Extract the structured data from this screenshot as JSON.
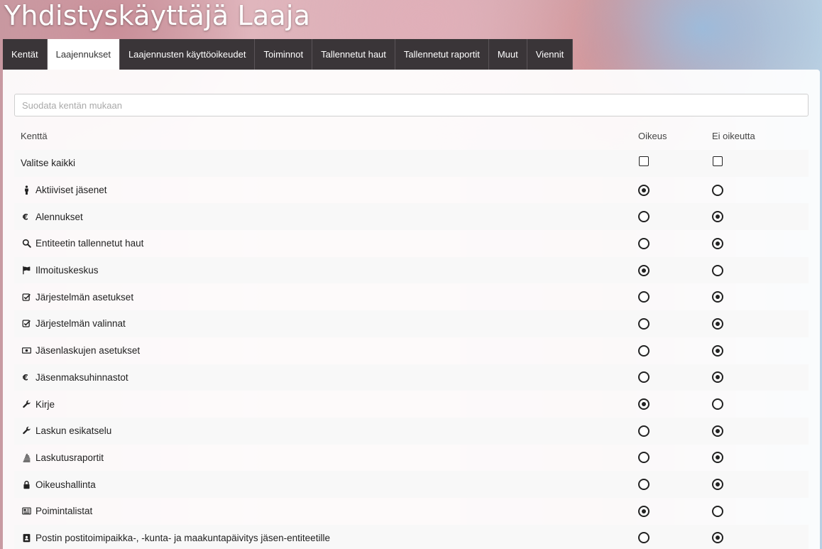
{
  "app": {
    "title": "Yhdistyskäyttäjä Laaja"
  },
  "tabs": [
    {
      "label": "Kentät",
      "active": false
    },
    {
      "label": "Laajennukset",
      "active": true
    },
    {
      "label": "Laajennusten käyttöoikeudet",
      "active": false
    },
    {
      "label": "Toiminnot",
      "active": false
    },
    {
      "label": "Tallennetut haut",
      "active": false
    },
    {
      "label": "Tallennetut raportit",
      "active": false
    },
    {
      "label": "Muut",
      "active": false
    },
    {
      "label": "Viennit",
      "active": false
    }
  ],
  "filter": {
    "placeholder": "Suodata kentän mukaan",
    "value": ""
  },
  "table": {
    "headers": {
      "field": "Kenttä",
      "right": "Oikeus",
      "no_right": "Ei oikeutta"
    },
    "select_all": {
      "label": "Valitse kaikki",
      "right_checked": false,
      "no_right_checked": false
    },
    "rows": [
      {
        "icon": "person-icon",
        "label": "Aktiiviset jäsenet",
        "value": "right"
      },
      {
        "icon": "euro-icon",
        "label": "Alennukset",
        "value": "no_right"
      },
      {
        "icon": "search-icon",
        "label": "Entiteetin tallennetut haut",
        "value": "no_right"
      },
      {
        "icon": "flag-icon",
        "label": "Ilmoituskeskus",
        "value": "right"
      },
      {
        "icon": "checkbox-checked-icon",
        "label": "Järjestelmän asetukset",
        "value": "no_right"
      },
      {
        "icon": "checkbox-checked-icon",
        "label": "Järjestelmän valinnat",
        "value": "no_right"
      },
      {
        "icon": "money-bill-icon",
        "label": "Jäsenlaskujen asetukset",
        "value": "no_right"
      },
      {
        "icon": "euro-icon",
        "label": "Jäsenmaksuhinnastot",
        "value": "no_right"
      },
      {
        "icon": "wrench-icon",
        "label": "Kirje",
        "value": "right"
      },
      {
        "icon": "wrench-icon",
        "label": "Laskun esikatselu",
        "value": "no_right"
      },
      {
        "icon": "coins-stack-icon",
        "label": "Laskutusraportit",
        "value": "no_right"
      },
      {
        "icon": "lock-icon",
        "label": "Oikeushallinta",
        "value": "no_right"
      },
      {
        "icon": "newspaper-icon",
        "label": "Poimintalistat",
        "value": "right"
      },
      {
        "icon": "contact-book-icon",
        "label": "Postin postitoimipaikka-, -kunta- ja maakuntapäivitys jäsen-entiteetille",
        "value": "no_right"
      }
    ]
  }
}
